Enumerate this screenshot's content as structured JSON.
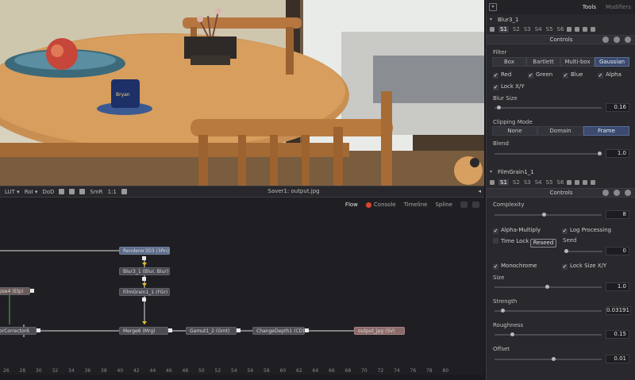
{
  "viewer": {
    "toolbar": {
      "lut": "LUT ▾",
      "roi": "RoI ▾",
      "dod": "DoD",
      "smr": "SmR",
      "ratio": "1:1",
      "title": "Saver1: output.jpg",
      "arrow": "◂"
    }
  },
  "flow": {
    "tabs": {
      "flow": "Flow",
      "console": "Console",
      "timeline": "Timeline",
      "spline": "Spline"
    },
    "nodes": {
      "renderer": "Renderer3D3 (3Rn)",
      "blur": "Blur3_1 (Blur, Blur)",
      "filmgrain": "FilmGrain1_1 (FGr)",
      "merge": "Merge6 (Mrg)",
      "gamut": "Gamut1_2 (Gmt)",
      "changedepth": "ChangeDepth1 (CD)",
      "saver": "output_jpg (SV)",
      "left_top": "pse4 (Elp)",
      "left_bottom": "orCorrector6"
    },
    "ruler": [
      "26",
      "28",
      "30",
      "32",
      "34",
      "36",
      "38",
      "40",
      "42",
      "44",
      "46",
      "48",
      "50",
      "52",
      "54",
      "56",
      "58",
      "60",
      "62",
      "64",
      "66",
      "68",
      "70",
      "72",
      "74",
      "76",
      "78",
      "80"
    ]
  },
  "inspector": {
    "tabs": {
      "tools": "Tools",
      "modifiers": "Modifiers"
    },
    "blur": {
      "name": "Blur3_1",
      "versions": [
        "S1",
        "S2",
        "S3",
        "S4",
        "S5",
        "S6"
      ],
      "controls_label": "Controls",
      "filter_label": "Filter",
      "filter_options": [
        "Box",
        "Bartlett",
        "Multi-box",
        "Gaussian"
      ],
      "filter_selected": "Gaussian",
      "channels": [
        "Red",
        "Green",
        "Blue",
        "Alpha"
      ],
      "lock_xy": "Lock X/Y",
      "blur_size_label": "Blur Size",
      "blur_size_value": "0.16",
      "blur_size_level": 0.02,
      "clipping_label": "Clipping Mode",
      "clipping_options": [
        "None",
        "Domain",
        "Frame"
      ],
      "clipping_selected": "Frame",
      "blend_label": "Blend",
      "blend_value": "1.0",
      "blend_level": 1.0
    },
    "grain": {
      "name": "FilmGrain1_1",
      "versions": [
        "S1",
        "S2",
        "S3",
        "S4",
        "S5",
        "S6"
      ],
      "controls_label": "Controls",
      "complexity_label": "Complexity",
      "complexity_value": "8",
      "alpha_multiply": "Alpha-Multiply",
      "log_processing": "Log Processing",
      "time_lock": "Time Lock",
      "reseed": "Reseed",
      "seed_label": "Seed",
      "seed_value": "0",
      "monochrome": "Monochrome",
      "lock_size_xy": "Lock Size X/Y",
      "size_label": "Size",
      "size_value": "1.0",
      "strength_label": "Strength",
      "strength_value": "0.03191",
      "roughness_label": "Roughness",
      "roughness_value": "0.15",
      "offset_label": "Offset",
      "offset_value": "0.01"
    }
  }
}
